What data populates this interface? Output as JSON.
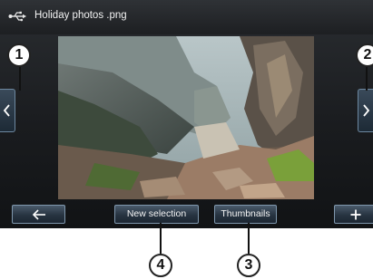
{
  "title_bar": {
    "file_name": "Holiday photos .png",
    "icon": "usb-icon"
  },
  "navigation": {
    "previous_icon": "chevron-left-icon",
    "next_icon": "chevron-right-icon"
  },
  "bottom_bar": {
    "back_icon": "arrow-left-icon",
    "new_selection_label": "New selection",
    "thumbnails_label": "Thumbnails",
    "add_icon": "plus-icon"
  },
  "callouts": {
    "one": "1",
    "two": "2",
    "three": "3",
    "four": "4"
  },
  "colors": {
    "screen_bg": "#1a1c1f",
    "button_border": "#7f97ad",
    "button_fill": "#273441"
  }
}
